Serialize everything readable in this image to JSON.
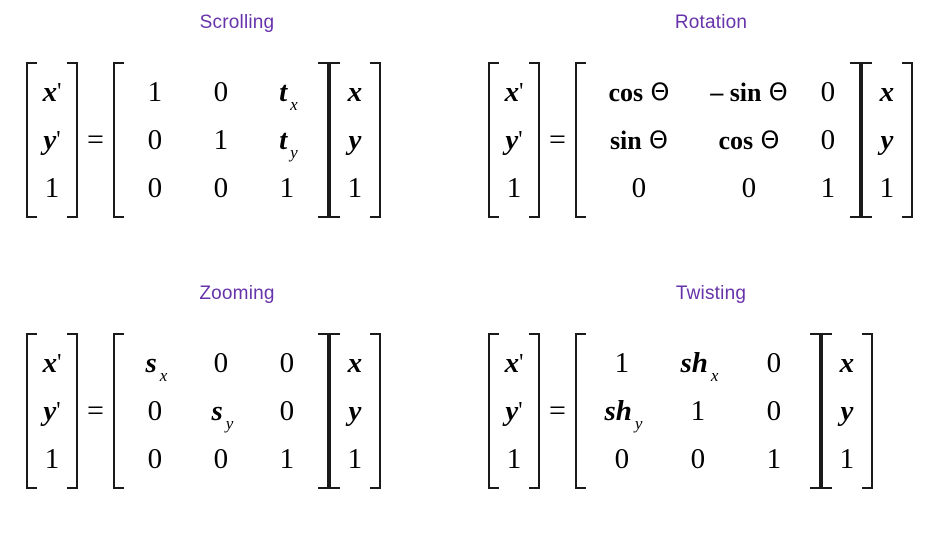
{
  "slide": {
    "title_color": "#6633aa",
    "text_color": "#000000",
    "background": "#ffffff"
  },
  "blocks": [
    {
      "id": "scrolling",
      "title": "Scrolling",
      "lhs_vector": [
        "x'",
        "y'",
        "1"
      ],
      "operator": "=",
      "matrix": [
        [
          "1",
          "0",
          "t",
          "x"
        ],
        [
          "0",
          "1",
          "t",
          "y"
        ],
        [
          "0",
          "0",
          "1",
          ""
        ]
      ],
      "rhs_vector": [
        "x",
        "y",
        "1"
      ],
      "cells": {
        "r0": {
          "c0": "1",
          "c1": "0",
          "c2_base": "t",
          "c2_sub": "x"
        },
        "r1": {
          "c0": "0",
          "c1": "1",
          "c2_base": "t",
          "c2_sub": "y"
        },
        "r2": {
          "c0": "0",
          "c1": "0",
          "c2_base": "1",
          "c2_sub": ""
        }
      },
      "lhs": {
        "r0_base": "x",
        "r0_prime": "'",
        "r1_base": "y",
        "r1_prime": "'",
        "r2": "1"
      },
      "rhs": {
        "r0": "x",
        "r1": "y",
        "r2": "1"
      }
    },
    {
      "id": "rotation",
      "title": "Rotation",
      "lhs_vector": [
        "x'",
        "y'",
        "1"
      ],
      "operator": "=",
      "matrix": [
        [
          "cos Θ",
          "– sin Θ",
          "0"
        ],
        [
          "sin Θ",
          "cos Θ",
          "0"
        ],
        [
          "0",
          "0",
          "1"
        ]
      ],
      "rhs_vector": [
        "x",
        "y",
        "1"
      ],
      "cells": {
        "r0": {
          "c0_fn": "cos",
          "c0_sym": "Θ",
          "c1_fn": "– sin",
          "c1_sym": "Θ",
          "c2": "0"
        },
        "r1": {
          "c0_fn": "sin",
          "c0_sym": "Θ",
          "c1_fn": "cos",
          "c1_sym": "Θ",
          "c2": "0"
        },
        "r2": {
          "c0_fn": "0",
          "c0_sym": "",
          "c1_fn": "0",
          "c1_sym": "",
          "c2": "1"
        }
      },
      "lhs": {
        "r0_base": "x",
        "r0_prime": "'",
        "r1_base": "y",
        "r1_prime": "'",
        "r2": "1"
      },
      "rhs": {
        "r0": "x",
        "r1": "y",
        "r2": "1"
      }
    },
    {
      "id": "zooming",
      "title": "Zooming",
      "lhs_vector": [
        "x'",
        "y'",
        "1"
      ],
      "operator": "=",
      "matrix": [
        [
          "s_x",
          "0",
          "0"
        ],
        [
          "0",
          "s_y",
          "0"
        ],
        [
          "0",
          "0",
          "1"
        ]
      ],
      "rhs_vector": [
        "x",
        "y",
        "1"
      ],
      "cells": {
        "r0": {
          "c0_base": "s",
          "c0_sub": "x",
          "c1": "0",
          "c2": "0"
        },
        "r1": {
          "c0": "0",
          "c1_base": "s",
          "c1_sub": "y",
          "c2": "0"
        },
        "r2": {
          "c0": "0",
          "c1": "0",
          "c2": "1"
        }
      },
      "lhs": {
        "r0_base": "x",
        "r0_prime": "'",
        "r1_base": "y",
        "r1_prime": "'",
        "r2": "1"
      },
      "rhs": {
        "r0": "x",
        "r1": "y",
        "r2": "1"
      }
    },
    {
      "id": "twisting",
      "title": "Twisting",
      "lhs_vector": [
        "x'",
        "y'",
        "1"
      ],
      "operator": "=",
      "matrix": [
        [
          "1",
          "sh_x",
          "0"
        ],
        [
          "sh_y",
          "1",
          "0"
        ],
        [
          "0",
          "0",
          "1"
        ]
      ],
      "rhs_vector": [
        "x",
        "y",
        "1"
      ],
      "cells": {
        "r0": {
          "c0": "1",
          "c1_base": "sh",
          "c1_sub": "x",
          "c2": "0"
        },
        "r1": {
          "c0_base": "sh",
          "c0_sub": "y",
          "c1": "1",
          "c2": "0"
        },
        "r2": {
          "c0": "0",
          "c1": "0",
          "c2": "1"
        }
      },
      "lhs": {
        "r0_base": "x",
        "r0_prime": "'",
        "r1_base": "y",
        "r1_prime": "'",
        "r2": "1"
      },
      "rhs": {
        "r0": "x",
        "r1": "y",
        "r2": "1"
      }
    }
  ]
}
